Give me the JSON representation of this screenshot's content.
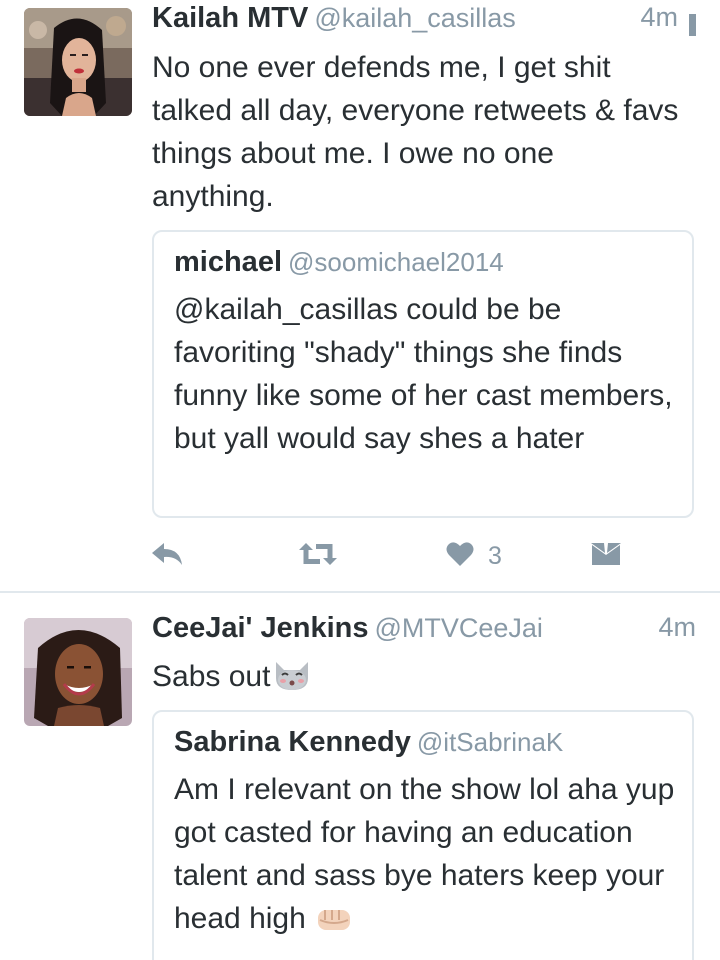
{
  "tweets": [
    {
      "name": "Kailah MTV",
      "handle": "@kailah_casillas",
      "time": "4m",
      "text": "No one ever defends me, I get shit talked all day, everyone retweets & favs things about me. I owe no one anything.",
      "quote": {
        "name": "michael",
        "handle": "@soomichael2014",
        "text": "@kailah_casillas could be be favoriting \"shady\" things she finds funny like some of her cast members, but yall would say shes a hater"
      },
      "actions": {
        "like_count": "3",
        "icons": [
          "reply-icon",
          "retweet-icon",
          "heart-icon",
          "direct-message-icon"
        ]
      }
    },
    {
      "name": "CeeJai' Jenkins",
      "handle": "@MTVCeeJai",
      "time": "4m",
      "text": "Sabs out",
      "emoji": "kissing-cat-emoji",
      "quote": {
        "name": "Sabrina Kennedy",
        "handle": "@itSabrinaK",
        "text": "Am I relevant on the show lol aha yup got casted for having an education talent and sass bye haters keep your head high",
        "emoji": "fist-emoji"
      }
    }
  ],
  "colors": {
    "text": "#292f33",
    "secondary": "#8899a6",
    "border": "#e1e8ed"
  }
}
